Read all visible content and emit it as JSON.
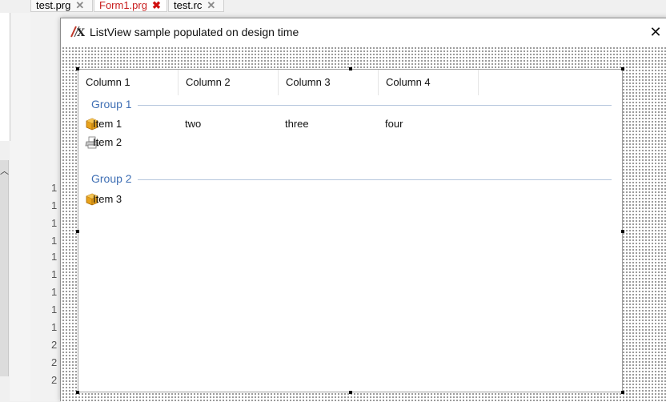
{
  "ide": {
    "tabs": [
      {
        "label": "test.prg",
        "close": "✕"
      },
      {
        "label": "Form1.prg",
        "close": "✖"
      },
      {
        "label": "test.rc",
        "close": "✕"
      }
    ],
    "line_numbers": [
      "1",
      "1",
      "1",
      "1",
      "1",
      "1",
      "1",
      "1",
      "1",
      "2",
      "2",
      "2"
    ]
  },
  "form": {
    "title": "ListView sample populated on design time",
    "close_glyph": "✕",
    "icon": "lx-logo-icon"
  },
  "listview": {
    "columns": [
      "Column 1",
      "Column 2",
      "Column 3",
      "Column 4"
    ],
    "groups": [
      {
        "label": "Group 1",
        "items": [
          {
            "icon": "package-icon",
            "cells": [
              "Item 1",
              "two",
              "three",
              "four"
            ]
          },
          {
            "icon": "printer-icon",
            "cells": [
              "Item 2",
              "",
              "",
              ""
            ]
          }
        ]
      },
      {
        "label": "Group 2",
        "items": [
          {
            "icon": "package-icon",
            "cells": [
              "Item 3",
              "",
              "",
              ""
            ]
          }
        ]
      }
    ],
    "colors": {
      "group_header": "#3f6fb4",
      "group_line": "#b5c6dd",
      "active_tab": "#c81e1e"
    }
  }
}
